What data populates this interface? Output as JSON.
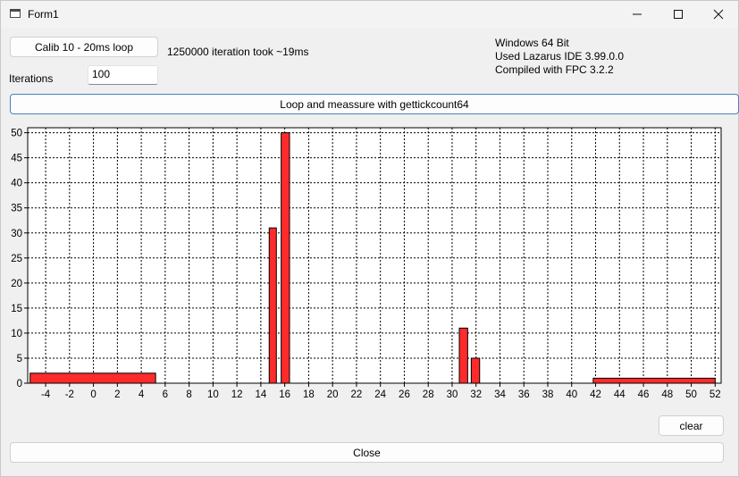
{
  "window": {
    "title": "Form1",
    "minimize_icon": "minimize-icon",
    "maximize_icon": "maximize-icon",
    "close_icon": "close-icon"
  },
  "controls": {
    "calib_button": "Calib 10 - 20ms loop",
    "calib_result": "1250000 iteration took ~19ms",
    "iterations_label": "Iterations",
    "iterations_value": "100",
    "loop_button": "Loop and meassure with gettickcount64",
    "clear_button": "clear",
    "close_button": "Close"
  },
  "info": {
    "line1": "Windows 64 Bit",
    "line2": "Used Lazarus IDE 3.99.0.0",
    "line3": "Compiled with FPC 3.2.2"
  },
  "chart_data": {
    "type": "bar",
    "title": "",
    "xlabel": "",
    "ylabel": "",
    "xlim": [
      -5.5,
      52.5
    ],
    "ylim": [
      0,
      51
    ],
    "xticks": [
      -4,
      -2,
      0,
      2,
      4,
      6,
      8,
      10,
      12,
      14,
      16,
      18,
      20,
      22,
      24,
      26,
      28,
      30,
      32,
      34,
      36,
      38,
      40,
      42,
      44,
      46,
      48,
      50,
      52
    ],
    "yticks": [
      0,
      5,
      10,
      15,
      20,
      25,
      30,
      35,
      40,
      45,
      50
    ],
    "grid": true,
    "bar_color": "#ff2b2b",
    "bars": [
      {
        "x_start": -5.3,
        "x_end": 5.2,
        "value": 2
      },
      {
        "x_start": 14.7,
        "x_end": 15.3,
        "value": 31
      },
      {
        "x_start": 15.7,
        "x_end": 16.4,
        "value": 50
      },
      {
        "x_start": 30.6,
        "x_end": 31.3,
        "value": 11
      },
      {
        "x_start": 31.6,
        "x_end": 32.3,
        "value": 5
      },
      {
        "x_start": 41.8,
        "x_end": 52.0,
        "value": 1
      }
    ]
  }
}
